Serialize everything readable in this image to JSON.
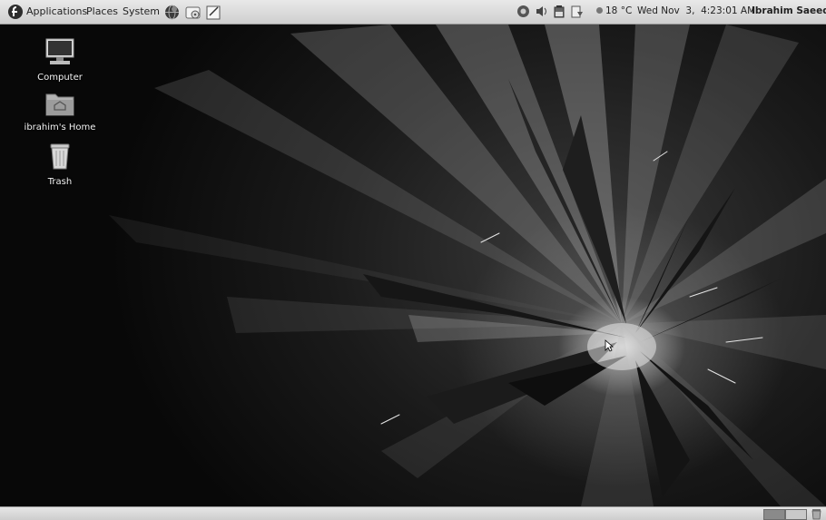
{
  "top_panel": {
    "menus": {
      "applications": "Applications",
      "places": "Places",
      "system": "System"
    },
    "launchers": [
      "globe-icon",
      "tools-icon",
      "notes-icon"
    ],
    "tray_icons": [
      "network-icon",
      "volume-icon",
      "battery-icon",
      "updates-icon"
    ],
    "weather": "18 °C",
    "datetime": "Wed Nov  3,  4:23:01 AM",
    "user": "Ibrahim Saeed"
  },
  "desktop": {
    "icons": [
      {
        "label": "Computer",
        "icon": "computer-icon"
      },
      {
        "label": "ibrahim's Home",
        "icon": "home-folder-icon"
      },
      {
        "label": "Trash",
        "icon": "trash-icon"
      }
    ]
  },
  "bottom_panel": {
    "workspaces": 2,
    "active_workspace": 1,
    "trash_icon": "trash-icon"
  }
}
